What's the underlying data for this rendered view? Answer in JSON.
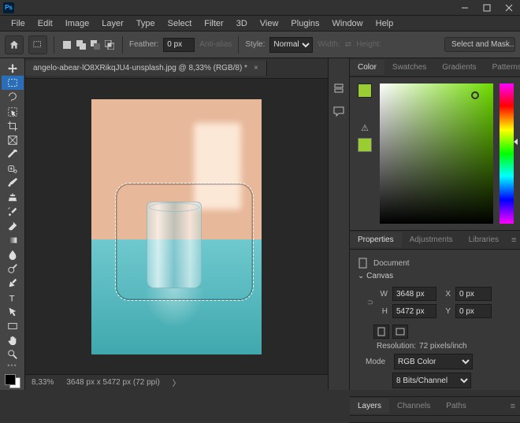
{
  "menubar": [
    "File",
    "Edit",
    "Image",
    "Layer",
    "Type",
    "Select",
    "Filter",
    "3D",
    "View",
    "Plugins",
    "Window",
    "Help"
  ],
  "optionsbar": {
    "feather_label": "Feather:",
    "feather_value": "0 px",
    "antialias_label": "Anti-alias",
    "style_label": "Style:",
    "style_value": "Normal",
    "width_label": "Width:",
    "height_label": "Height:",
    "select_mask": "Select and Mask..."
  },
  "document": {
    "tab_title": "angelo-abear-lO8XRikqJU4-unsplash.jpg @ 8,33% (RGB/8) *",
    "zoom": "8,33%",
    "dims": "3648 px x 5472 px (72 ppi)"
  },
  "color_panel": {
    "tabs": [
      "Color",
      "Swatches",
      "Gradients",
      "Patterns"
    ]
  },
  "properties_panel": {
    "tabs": [
      "Properties",
      "Adjustments",
      "Libraries"
    ],
    "doc_label": "Document",
    "canvas_label": "Canvas",
    "w_label": "W",
    "w_value": "3648 px",
    "h_label": "H",
    "h_value": "5472 px",
    "x_label": "X",
    "x_value": "0 px",
    "y_label": "Y",
    "y_value": "0 px",
    "resolution_label": "Resolution:",
    "resolution_value": "72 pixels/inch",
    "mode_label": "Mode",
    "mode_value": "RGB Color",
    "depth_value": "8 Bits/Channel"
  },
  "layers_panel": {
    "tabs": [
      "Layers",
      "Channels",
      "Paths"
    ]
  },
  "tools": [
    "move-tool",
    "rectangular-marquee-tool",
    "lasso-tool",
    "object-selection-tool",
    "crop-tool",
    "frame-tool",
    "eyedropper-tool",
    "healing-brush-tool",
    "brush-tool",
    "clone-stamp-tool",
    "history-brush-tool",
    "eraser-tool",
    "gradient-tool",
    "blur-tool",
    "dodge-tool",
    "pen-tool",
    "type-tool",
    "path-selection-tool",
    "rectangle-tool",
    "hand-tool",
    "zoom-tool"
  ]
}
